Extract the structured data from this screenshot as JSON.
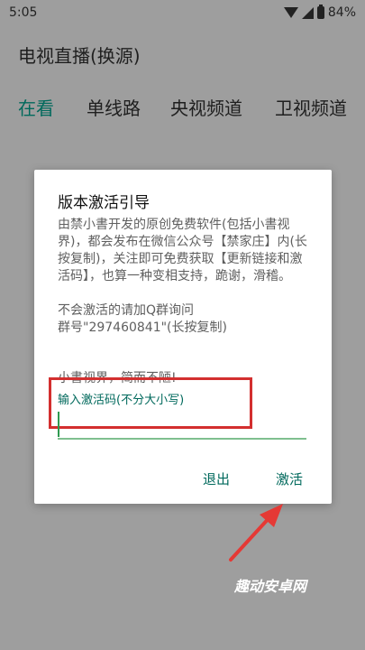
{
  "status": {
    "time": "5:05",
    "battery": "84%"
  },
  "app": {
    "title": "电视直播(换源)"
  },
  "tabs": [
    {
      "label": "在看",
      "active": true
    },
    {
      "label": "单线路",
      "active": false
    },
    {
      "label": "央视频道",
      "active": false
    },
    {
      "label": "卫视频道",
      "active": false
    }
  ],
  "dialog": {
    "title": "版本激活引导",
    "message": "由禁小書开发的原创免费软件(包括小書视界)，都会发布在微信公众号【禁家庄】内(长按复制)，关注即可免费获取【更新链接和激活码】，也算一种变相支持，跪谢，滑稽。\n\n不会激活的请加Q群询问\n群号\"297460841\"(长按复制)",
    "footer": "小書视界，简而不陋!",
    "input_placeholder": "输入激活码(不分大小写)",
    "input_value": "",
    "cancel_label": "退出",
    "activate_label": "激活"
  },
  "watermark": "趣动安卓网",
  "colors": {
    "accent": "#00695c",
    "highlight": "#d32f2f",
    "overlay": "#9e9e9e"
  }
}
